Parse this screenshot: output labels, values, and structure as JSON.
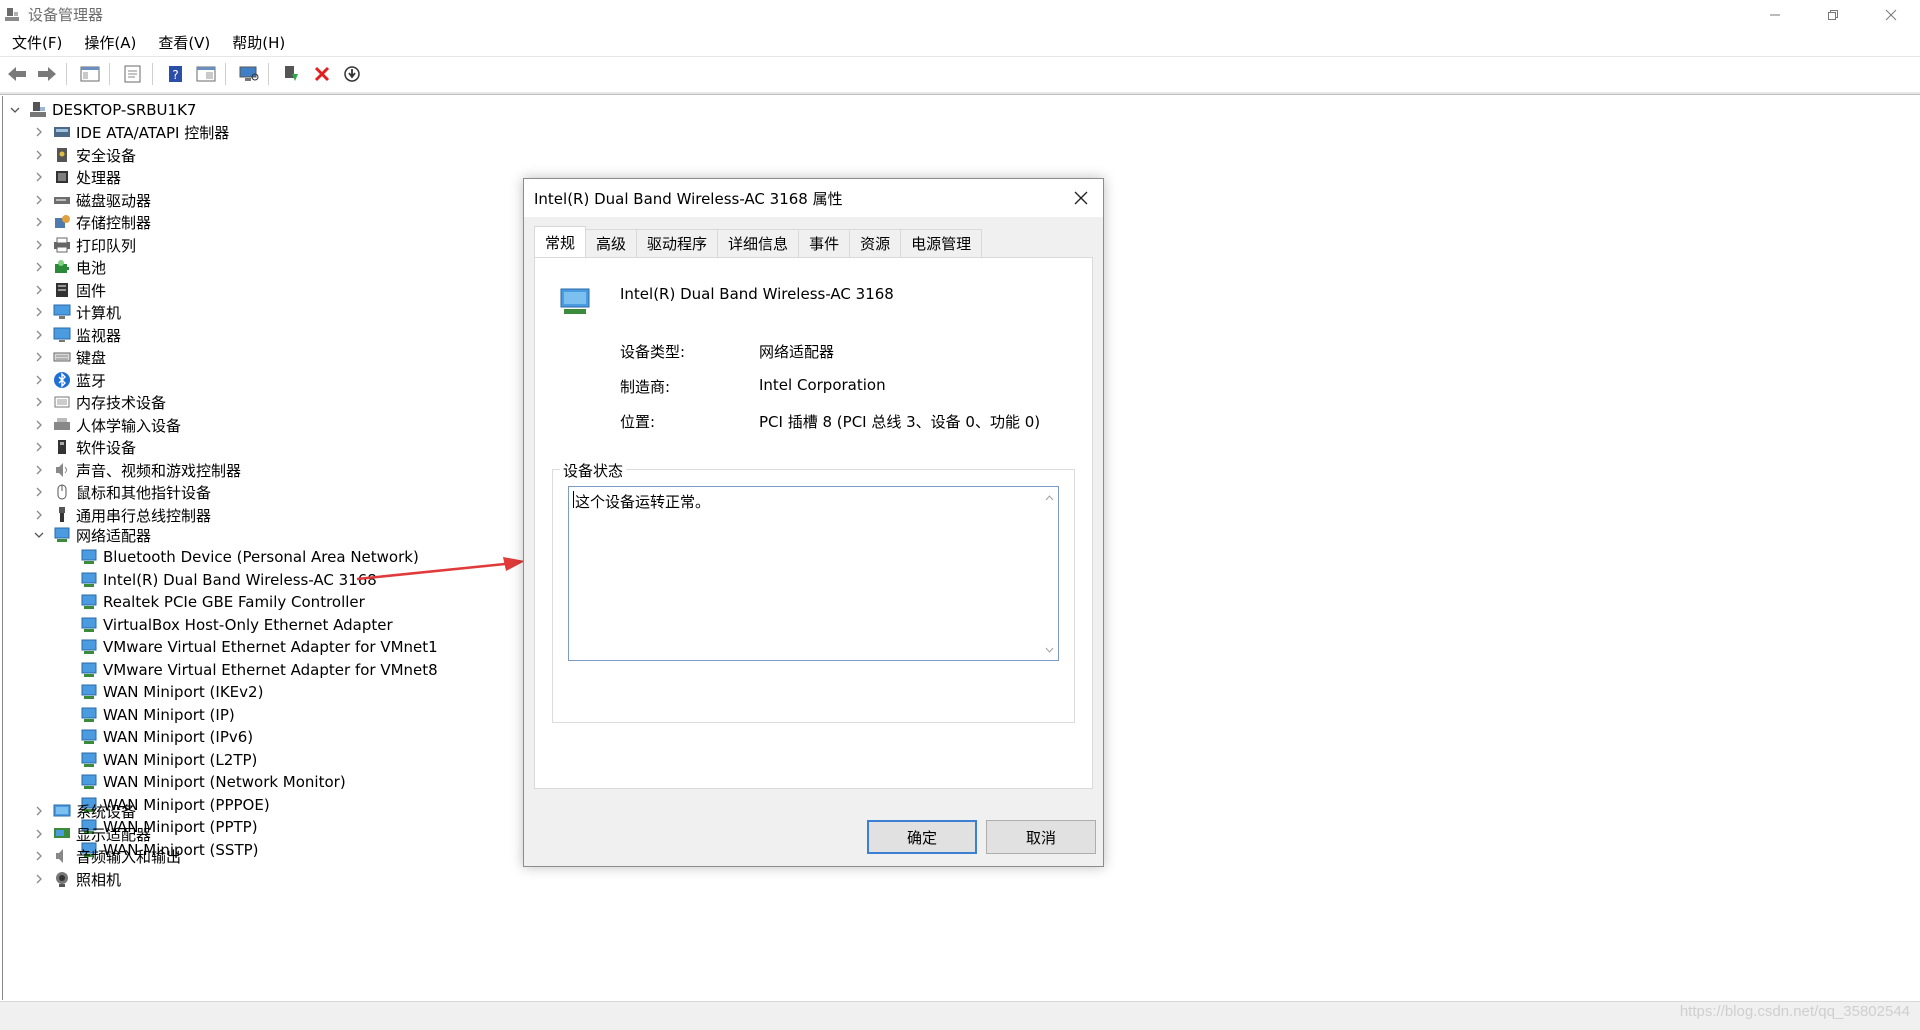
{
  "window": {
    "title": "设备管理器"
  },
  "menu": [
    "文件(F)",
    "操作(A)",
    "查看(V)",
    "帮助(H)"
  ],
  "tree": {
    "root": "DESKTOP-SRBU1K7",
    "categories_before": [
      {
        "label": "IDE ATA/ATAPI 控制器",
        "icon": "ide-controller-icon"
      },
      {
        "label": "安全设备",
        "icon": "security-device-icon"
      },
      {
        "label": "处理器",
        "icon": "processor-icon"
      },
      {
        "label": "磁盘驱动器",
        "icon": "disk-drive-icon"
      },
      {
        "label": "存储控制器",
        "icon": "storage-controller-icon"
      },
      {
        "label": "打印队列",
        "icon": "printer-icon"
      },
      {
        "label": "电池",
        "icon": "battery-icon"
      },
      {
        "label": "固件",
        "icon": "firmware-icon"
      },
      {
        "label": "计算机",
        "icon": "computer-icon"
      },
      {
        "label": "监视器",
        "icon": "monitor-icon"
      },
      {
        "label": "键盘",
        "icon": "keyboard-icon"
      },
      {
        "label": "蓝牙",
        "icon": "bluetooth-icon"
      },
      {
        "label": "内存技术设备",
        "icon": "memory-device-icon"
      },
      {
        "label": "人体学输入设备",
        "icon": "hid-icon"
      },
      {
        "label": "软件设备",
        "icon": "software-device-icon"
      },
      {
        "label": "声音、视频和游戏控制器",
        "icon": "sound-icon"
      },
      {
        "label": "鼠标和其他指针设备",
        "icon": "mouse-icon"
      },
      {
        "label": "通用串行总线控制器",
        "icon": "usb-icon"
      }
    ],
    "expanded": {
      "label": "网络适配器",
      "icon": "network-adapter-icon"
    },
    "network_children": [
      "Bluetooth Device (Personal Area Network)",
      "Intel(R) Dual Band Wireless-AC 3168",
      "Realtek PCIe GBE Family Controller",
      "VirtualBox Host-Only Ethernet Adapter",
      "VMware Virtual Ethernet Adapter for VMnet1",
      "VMware Virtual Ethernet Adapter for VMnet8",
      "WAN Miniport (IKEv2)",
      "WAN Miniport (IP)",
      "WAN Miniport (IPv6)",
      "WAN Miniport (L2TP)",
      "WAN Miniport (Network Monitor)",
      "WAN Miniport (PPPOE)",
      "WAN Miniport (PPTP)",
      "WAN Miniport (SSTP)"
    ],
    "categories_after": [
      {
        "label": "系统设备",
        "icon": "system-device-icon"
      },
      {
        "label": "显示适配器",
        "icon": "display-adapter-icon"
      },
      {
        "label": "音频输入和输出",
        "icon": "audio-io-icon"
      },
      {
        "label": "照相机",
        "icon": "camera-icon"
      }
    ]
  },
  "dialog": {
    "title": "Intel(R) Dual Band Wireless-AC 3168 属性",
    "tabs": [
      "常规",
      "高级",
      "驱动程序",
      "详细信息",
      "事件",
      "资源",
      "电源管理"
    ],
    "device_name": "Intel(R) Dual Band Wireless-AC 3168",
    "properties": [
      {
        "label": "设备类型:",
        "value": "网络适配器"
      },
      {
        "label": "制造商:",
        "value": "Intel Corporation"
      },
      {
        "label": "位置:",
        "value": "PCI 插槽 8 (PCI 总线 3、设备 0、功能 0)"
      }
    ],
    "status_group_label": "设备状态",
    "status_text": "这个设备运转正常。",
    "ok_label": "确定",
    "cancel_label": "取消"
  },
  "watermark": "https://blog.csdn.net/qq_35802544",
  "colors": {
    "accent": "#3c7fd4",
    "annotation_arrow": "#e03a3a"
  }
}
